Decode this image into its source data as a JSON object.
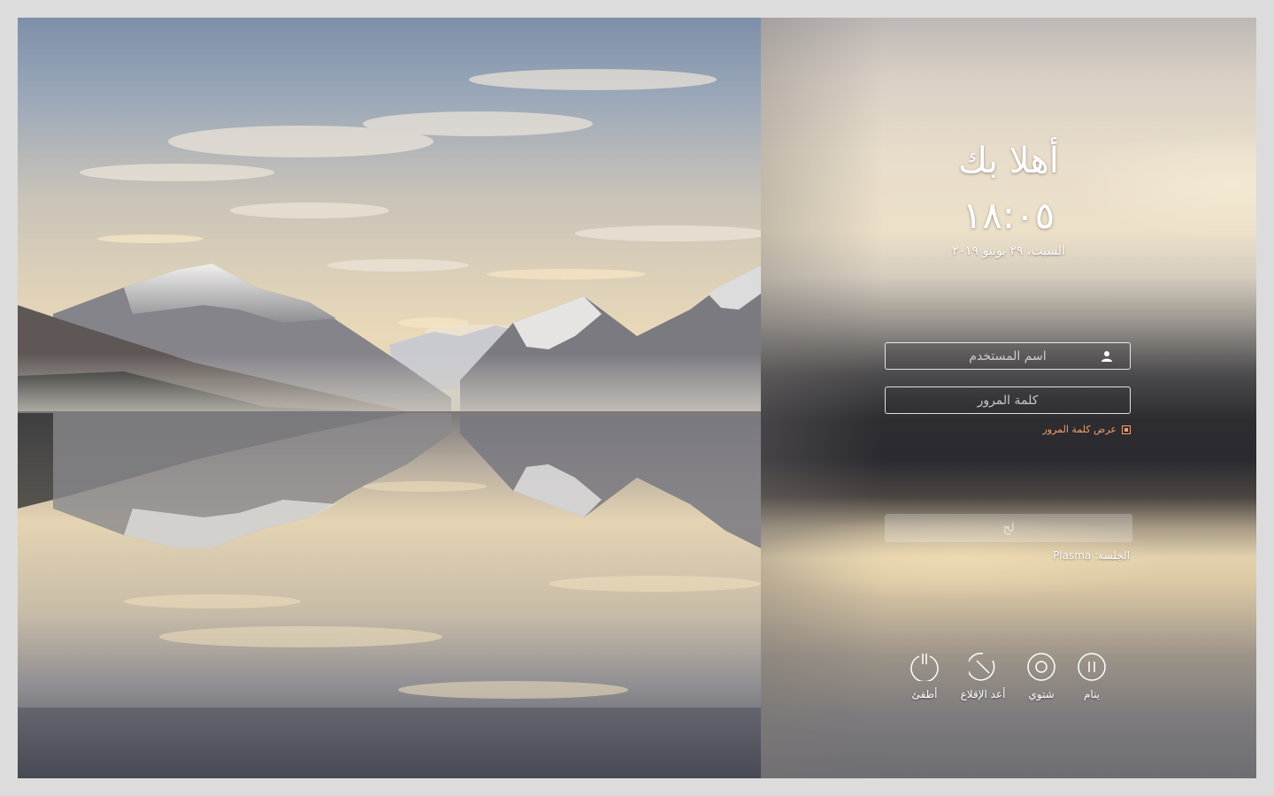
{
  "greeting": "أهلا بك",
  "clock": "١٨:٠٥",
  "date": "السبت، ٢٩ يونيو ٢٠١٩",
  "username": {
    "placeholder": "اسم المستخدم",
    "icon": "user-icon"
  },
  "password": {
    "placeholder": "كلمة المرور"
  },
  "show_password": {
    "label": "عرض كلمة المرور",
    "checked": true
  },
  "login_button": {
    "label": "لج"
  },
  "session": {
    "label": "الجلسة:",
    "value": "Plasma"
  },
  "actions": [
    {
      "label": "ينام",
      "icon": "pause-icon"
    },
    {
      "label": "شتوي",
      "icon": "hibernate-icon"
    },
    {
      "label": "أعد الإقلاع",
      "icon": "restart-icon"
    },
    {
      "label": "أطفئ",
      "icon": "power-icon"
    }
  ],
  "colors": {
    "accent": "#f3a06a",
    "text": "#ffffff",
    "page_background": "#dcdcdc"
  }
}
